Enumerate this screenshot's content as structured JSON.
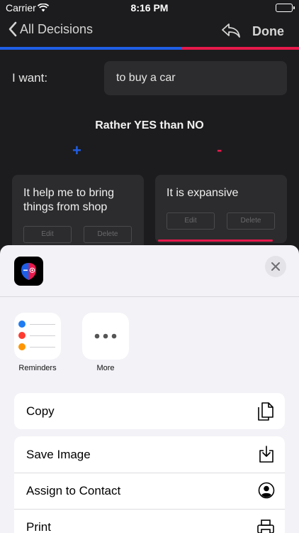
{
  "status_bar": {
    "carrier": "Carrier",
    "time": "8:16 PM"
  },
  "nav": {
    "back_label": "All Decisions",
    "done_label": "Done"
  },
  "progress": {
    "blue_fraction": 0.61,
    "blue_color": "#1f5ee6",
    "red_color": "#e6194b"
  },
  "want": {
    "label": "I want:",
    "value": "to buy a car"
  },
  "rather_label": "Rather YES than NO",
  "pros_symbol": "+",
  "cons_symbol": "-",
  "pros": [
    {
      "text": "It help me to bring things from shop",
      "edit_label": "Edit",
      "delete_label": "Delete"
    }
  ],
  "cons": [
    {
      "text": "It is expansive",
      "edit_label": "Edit",
      "delete_label": "Delete"
    }
  ],
  "share_sheet": {
    "apps": [
      {
        "label": "Reminders",
        "icon": "reminders-icon"
      },
      {
        "label": "More",
        "icon": "more-icon"
      }
    ],
    "actions": {
      "copy": {
        "label": "Copy",
        "icon": "copy-icon"
      },
      "save_image": {
        "label": "Save Image",
        "icon": "download-icon"
      },
      "assign_contact": {
        "label": "Assign to Contact",
        "icon": "contact-icon"
      },
      "print": {
        "label": "Print",
        "icon": "printer-icon"
      }
    }
  }
}
